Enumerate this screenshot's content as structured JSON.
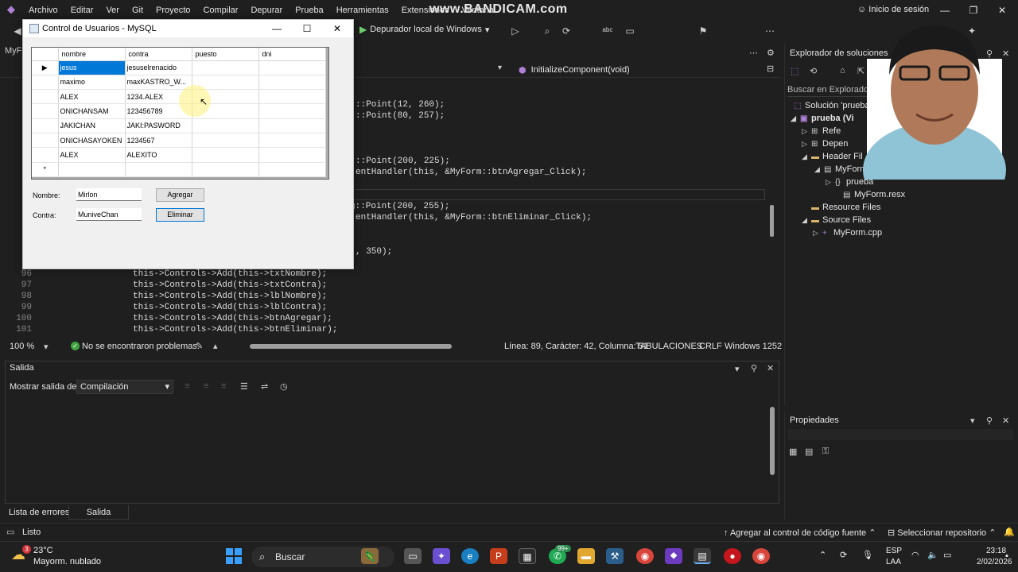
{
  "menubar": {
    "items": [
      "Archivo",
      "Editar",
      "Ver",
      "Git",
      "Proyecto",
      "Compilar",
      "Depurar",
      "Prueba",
      "Herramientas",
      "Extensiones",
      "Ventana"
    ],
    "watermark": "www.BANDICAM.com",
    "signin": "Inicio de sesión"
  },
  "toolbar": {
    "debug_label": "Depurador local de Windows"
  },
  "editor": {
    "tab_label": "MyF",
    "member_combo": "InitializeComponent(void)",
    "code_fragments": [
      "::Point(12, 260);",
      "::Point(80, 257);",
      "::Point(200, 225);",
      "entHandler(this, &MyForm::btnAgregar_Click);",
      "g::Point(200, 255);",
      "entHandler(this, &MyForm::btnEliminar_Click);",
      ", 350);"
    ],
    "lines": [
      {
        "num": "96",
        "code": "this->Controls->Add(this->txtNombre);"
      },
      {
        "num": "97",
        "code": "this->Controls->Add(this->txtContra);"
      },
      {
        "num": "98",
        "code": "this->Controls->Add(this->lblNombre);"
      },
      {
        "num": "99",
        "code": "this->Controls->Add(this->lblContra);"
      },
      {
        "num": "100",
        "code": "this->Controls->Add(this->btnAgregar);"
      },
      {
        "num": "101",
        "code": "this->Controls->Add(this->btnEliminar);"
      }
    ],
    "status": {
      "zoom": "100 %",
      "problems": "No se encontraron problemas.",
      "position": "Línea: 89, Carácter: 42, Columna: 51",
      "tabs": "TABULACIONES",
      "eol": "CRLF",
      "encoding": "Windows 1252"
    }
  },
  "output": {
    "title": "Salida",
    "show_label": "Mostrar salida de:",
    "source": "Compilación",
    "tabs": [
      "Lista de errores",
      "Salida"
    ]
  },
  "solution_explorer": {
    "title": "Explorador de soluciones",
    "search_placeholder": "Buscar en Explorador de solu",
    "nodes": [
      {
        "label": "Solución 'prueba' (1 de",
        "icon": "solution-icon"
      },
      {
        "label": "prueba (Vi",
        "icon": "project-icon"
      },
      {
        "label": "Refe",
        "icon": "references-icon"
      },
      {
        "label": "Depen",
        "icon": "dependencies-icon"
      },
      {
        "label": "Header Fil",
        "icon": "folder-icon"
      },
      {
        "label": "MyForm.h",
        "icon": "header-file-icon"
      },
      {
        "label": "prueba",
        "icon": "namespace-icon"
      },
      {
        "label": "MyForm.resx",
        "icon": "resx-file-icon"
      },
      {
        "label": "Resource Files",
        "icon": "folder-icon"
      },
      {
        "label": "Source Files",
        "icon": "folder-icon"
      },
      {
        "label": "MyForm.cpp",
        "icon": "cpp-file-icon"
      }
    ]
  },
  "properties": {
    "title": "Propiedades"
  },
  "statusbar": {
    "ready": "Listo",
    "source_control": "Agregar al control de código fuente",
    "repo": "Seleccionar repositorio"
  },
  "taskbar": {
    "weather_temp": "23°C",
    "weather_desc": "Mayorm. nublado",
    "weather_badge": "3",
    "search_placeholder": "Buscar",
    "whatsapp_badge": "99+",
    "lang1": "ESP",
    "lang2": "LAA",
    "time": "23:18",
    "date": "2/02/2026"
  },
  "winform": {
    "title": "Control de Usuarios - MySQL",
    "columns": [
      "nombre",
      "contra",
      "puesto",
      "dni"
    ],
    "rows": [
      [
        "jesus",
        "jesuselrenacido",
        "",
        ""
      ],
      [
        "maximo",
        "maxKASTRO_W...",
        "",
        ""
      ],
      [
        "ALEX",
        "1234.ALEX",
        "",
        ""
      ],
      [
        "ONICHANSAM",
        "123456789",
        "",
        ""
      ],
      [
        "JAKICHAN",
        "JAKI:PASWORD",
        "",
        ""
      ],
      [
        "ONICHASAYOKEN",
        "1234567",
        "",
        ""
      ],
      [
        "ALEX",
        "ALEXITO",
        "",
        ""
      ]
    ],
    "nombre_label": "Nombre:",
    "contra_label": "Contra:",
    "nombre_value": "Mirlon",
    "contra_value": "MuniveChan",
    "agregar_label": "Agregar",
    "eliminar_label": "Eliminar"
  },
  "colors": {
    "ide_bg": "#1f1f1f",
    "accent_purple": "#b180d7",
    "selection_blue": "#0078d7",
    "ok_green": "#3fa33f"
  }
}
